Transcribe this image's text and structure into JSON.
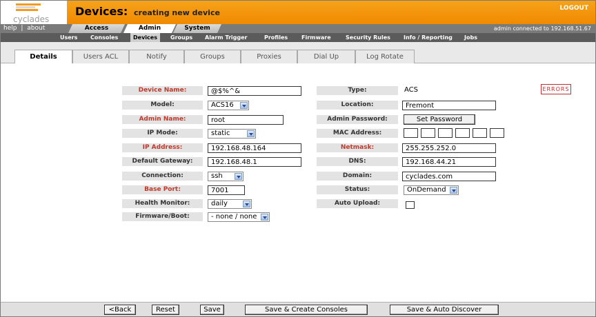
{
  "header": {
    "logo_text": "cyclades",
    "title": "Devices:",
    "subtitle": "creating new device",
    "logout": "LOGOUT"
  },
  "topbar": {
    "help": "help",
    "separator": "|",
    "about": "about",
    "main_tabs": [
      "Access",
      "Admin",
      "System"
    ],
    "status": "admin connected to 192.168.51.67"
  },
  "submenu": [
    "Users",
    "Consoles",
    "Devices",
    "Groups",
    "Alarm Trigger",
    "Profiles",
    "Firmware",
    "Security Rules",
    "Info / Reporting",
    "Jobs"
  ],
  "tabs": [
    "Details",
    "Users ACL",
    "Notify",
    "Groups",
    "Proxies",
    "Dial Up",
    "Log Rotate"
  ],
  "errors_label": "ERRORS",
  "form": {
    "left": {
      "device_name_label": "Device Name:",
      "device_name_value": "@$%^&",
      "model_label": "Model:",
      "model_value": "ACS16",
      "admin_name_label": "Admin Name:",
      "admin_name_value": "root",
      "ip_mode_label": "IP Mode:",
      "ip_mode_value": "static",
      "ip_address_label": "IP Address:",
      "ip_address_value": "192.168.48.164",
      "gateway_label": "Default Gateway:",
      "gateway_value": "192.168.48.1",
      "connection_label": "Connection:",
      "connection_value": "ssh",
      "base_port_label": "Base Port:",
      "base_port_value": "7001",
      "health_label": "Health Monitor:",
      "health_value": "daily",
      "firmware_label": "Firmware/Boot:",
      "firmware_value": "- none / none"
    },
    "right": {
      "type_label": "Type:",
      "type_value": "ACS",
      "location_label": "Location:",
      "location_value": "Fremont",
      "admin_password_label": "Admin Password:",
      "set_password_button": "Set Password",
      "mac_label": "MAC Address:",
      "netmask_label": "Netmask:",
      "netmask_value": "255.255.252.0",
      "dns_label": "DNS:",
      "dns_value": "192.168.44.21",
      "domain_label": "Domain:",
      "domain_value": "cyclades.com",
      "status_label": "Status:",
      "status_value": "OnDemand",
      "auto_upload_label": "Auto Upload:"
    }
  },
  "buttons": {
    "back": "<Back",
    "reset": "Reset",
    "save": "Save",
    "save_consoles": "Save & Create Consoles",
    "save_discover": "Save & Auto Discover"
  },
  "colors": {
    "header_orange": "#f08a00",
    "required_red": "#c0392b",
    "label_bg": "#e3e3e3"
  }
}
